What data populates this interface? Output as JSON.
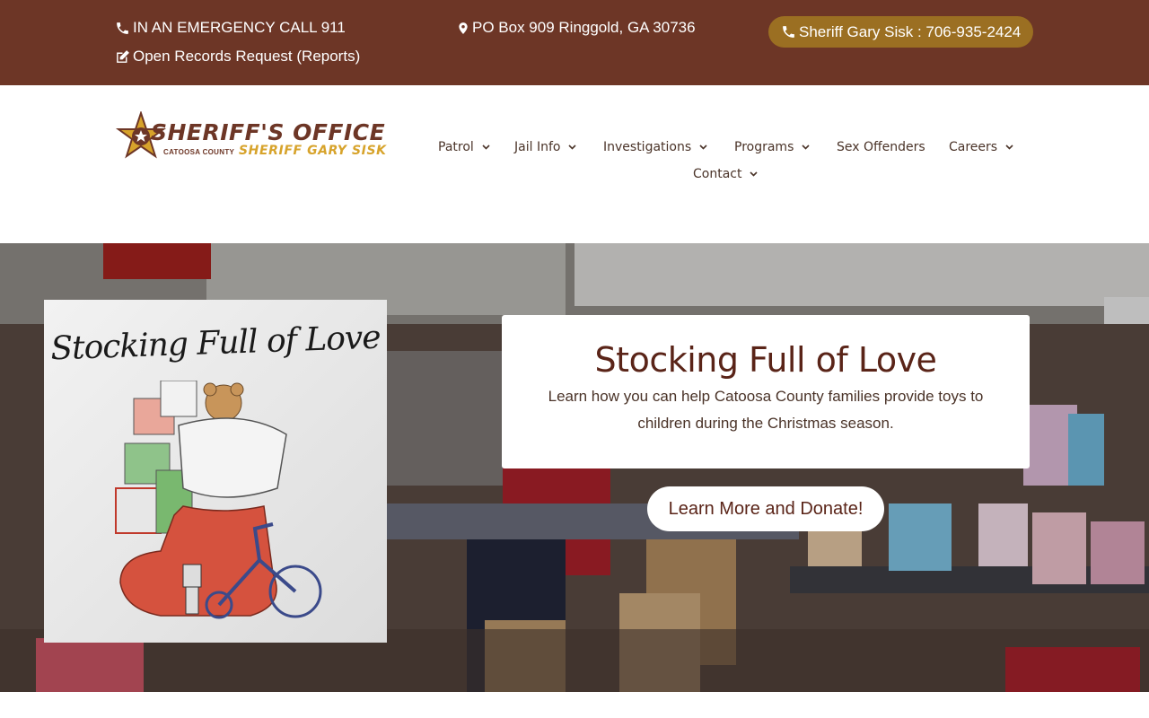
{
  "topbar": {
    "emergency": "IN AN EMERGENCY CALL 911",
    "records": "Open Records Request (Reports)",
    "address": "PO Box 909 Ringgold, GA 30736",
    "phone": "Sheriff Gary Sisk : 706-935-2424",
    "background_color": "#6d3626",
    "phone_badge_color": "#9b6f22",
    "icons": [
      "phone-icon",
      "edit-icon",
      "map-marker-icon",
      "phone-icon"
    ]
  },
  "logo": {
    "title": "SHERIFF'S OFFICE",
    "county": "CATOOSA COUNTY",
    "sheriff": "SHERIFF GARY SISK",
    "icon": "star-badge-icon"
  },
  "nav": {
    "items": [
      {
        "label": "Patrol",
        "has_dropdown": true
      },
      {
        "label": "Jail Info",
        "has_dropdown": true
      },
      {
        "label": "Investigations",
        "has_dropdown": true
      },
      {
        "label": "Programs",
        "has_dropdown": true
      },
      {
        "label": "Sex Offenders",
        "has_dropdown": false
      },
      {
        "label": "Careers",
        "has_dropdown": true
      },
      {
        "label": "Contact",
        "has_dropdown": true
      }
    ]
  },
  "hero": {
    "poster_title": "Stocking Full of Love",
    "title": "Stocking Full of Love",
    "text": "Learn how you can help Catoosa County families provide toys to children during the Christmas season.",
    "button": "Learn More and Donate!",
    "accent_color": "#5a2418"
  }
}
